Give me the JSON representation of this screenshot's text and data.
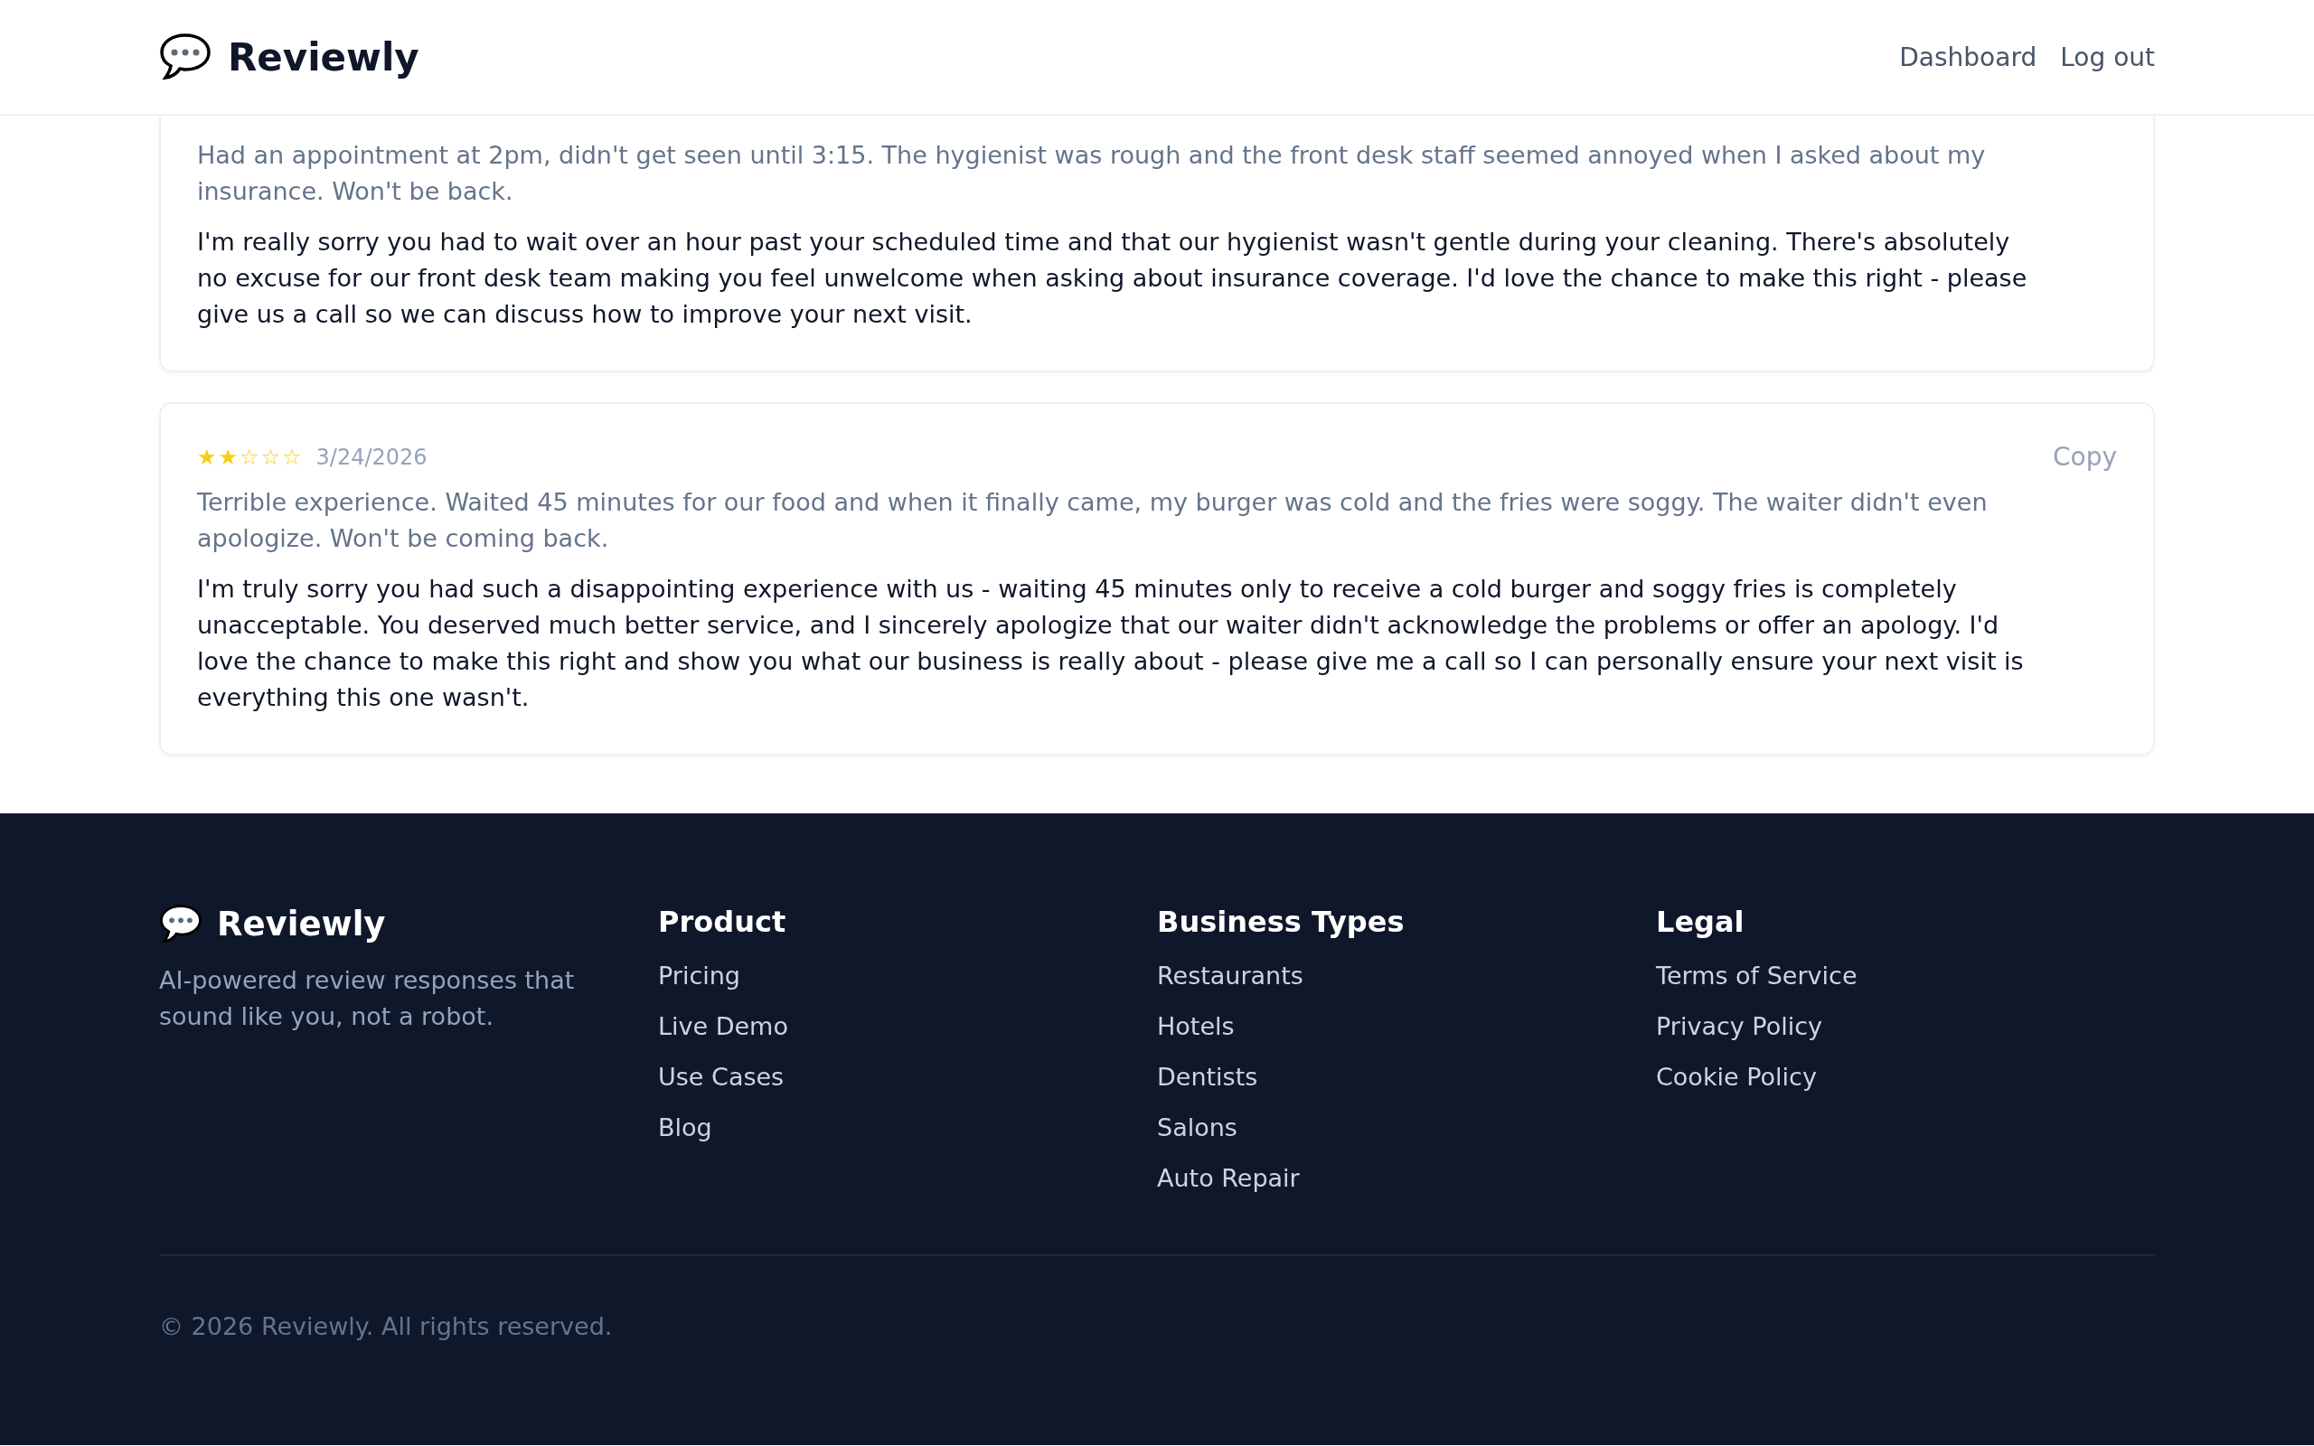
{
  "header": {
    "brand": "Reviewly",
    "nav": [
      "Dashboard",
      "Log out"
    ]
  },
  "reviews": [
    {
      "review": "Had an appointment at 2pm, didn't get seen until 3:15. The hygienist was rough and the front desk staff seemed annoyed when I asked about my insurance. Won't be back.",
      "response": "I'm really sorry you had to wait over an hour past your scheduled time and that our hygienist wasn't gentle during your cleaning. There's absolutely no excuse for our front desk team making you feel unwelcome when asking about insurance coverage. I'd love the chance to make this right - please give us a call so we can discuss how to improve your next visit."
    },
    {
      "stars": 2,
      "date": "3/24/2026",
      "copy": "Copy",
      "review": "Terrible experience. Waited 45 minutes for our food and when it finally came, my burger was cold and the fries were soggy. The waiter didn't even apologize. Won't be coming back.",
      "response": "I'm truly sorry you had such a disappointing experience with us - waiting 45 minutes only to receive a cold burger and soggy fries is completely unacceptable. You deserved much better service, and I sincerely apologize that our waiter didn't acknowledge the problems or offer an apology. I'd love the chance to make this right and show you what our business is really about - please give me a call so I can personally ensure your next visit is everything this one wasn't."
    }
  ],
  "footer": {
    "brand": "Reviewly",
    "tagline": "AI-powered review responses that sound like you, not a robot.",
    "columns": [
      {
        "heading": "Product",
        "links": [
          "Pricing",
          "Live Demo",
          "Use Cases",
          "Blog"
        ]
      },
      {
        "heading": "Business Types",
        "links": [
          "Restaurants",
          "Hotels",
          "Dentists",
          "Salons",
          "Auto Repair"
        ]
      },
      {
        "heading": "Legal",
        "links": [
          "Terms of Service",
          "Privacy Policy",
          "Cookie Policy"
        ]
      }
    ],
    "copyright": "© 2026 Reviewly. All rights reserved."
  }
}
